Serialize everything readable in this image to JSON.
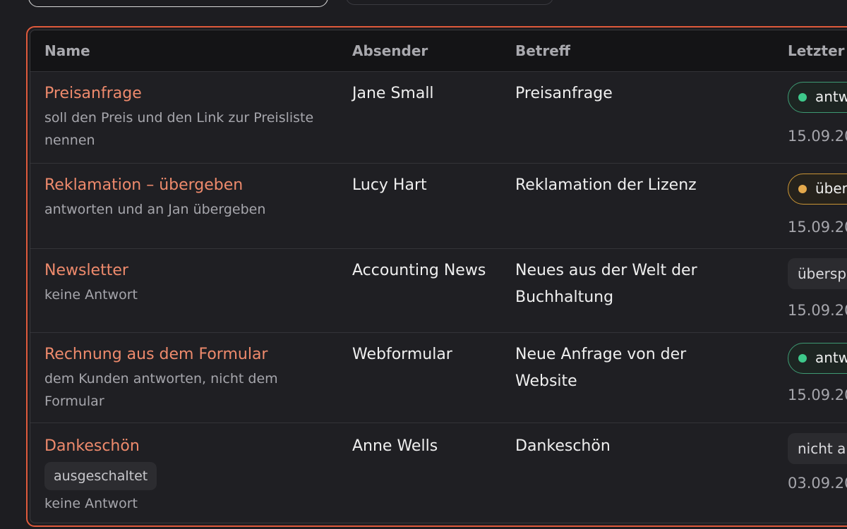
{
  "table": {
    "headers": {
      "name": "Name",
      "sender": "Absender",
      "subject": "Betreff",
      "last": "Letzter "
    },
    "rows": [
      {
        "title": "Preisanfrage",
        "description": "soll den Preis und den Link zur Preisliste nennen",
        "sender": "Jane Small",
        "subject": "Preisanfrage",
        "status": "antw",
        "status_color": "#3ec98b",
        "date": "15.09.20"
      },
      {
        "title": "Reklamation – übergeben",
        "description": "antworten und an Jan übergeben",
        "sender": "Lucy Hart",
        "subject": "Reklamation der Lizenz",
        "status": "über",
        "status_color": "#e4a94c",
        "date": "15.09.20"
      },
      {
        "title": "Newsletter",
        "description": "keine Antwort",
        "sender": "Accounting News",
        "subject": "Neues aus der Welt der Buchhaltung",
        "status": "übersp",
        "date": "15.09.20"
      },
      {
        "title": "Rechnung aus dem Formular",
        "description": "dem Kunden antworten, nicht dem Formular",
        "sender": "Webformular",
        "subject": "Neue Anfrage von der Website",
        "status": "antw",
        "status_color": "#3ec98b",
        "date": "15.09.20"
      },
      {
        "title": "Dankeschön",
        "tag": "ausgeschaltet",
        "description": "keine Antwort",
        "sender": "Anne Wells",
        "subject": "Dankeschön",
        "status": "nicht a",
        "date": "03.09.20"
      }
    ]
  },
  "colors": {
    "accent": "#e05a3c",
    "rule_title": "#ee8a6c",
    "background": "#1d1d21"
  }
}
